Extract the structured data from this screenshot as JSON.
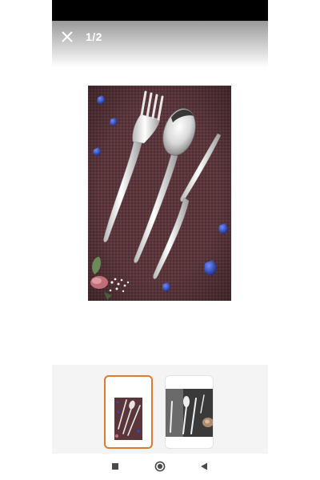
{
  "colors": {
    "status_bar": "#000000",
    "thumb_selected_border": "#e07a2c",
    "thumb_strip_bg": "#f4f4f4",
    "image_background": "#5a363b"
  },
  "header": {
    "close_icon": "close-icon",
    "page_counter": "1/2"
  },
  "gallery": {
    "main_image_subject": "fork-spoon-knife-cutlery-set",
    "thumbnails": [
      {
        "selected": true
      },
      {
        "selected": false
      }
    ]
  },
  "nav_bar": {
    "recent_icon": "square-icon",
    "home_icon": "circle-icon",
    "back_icon": "triangle-back-icon"
  }
}
